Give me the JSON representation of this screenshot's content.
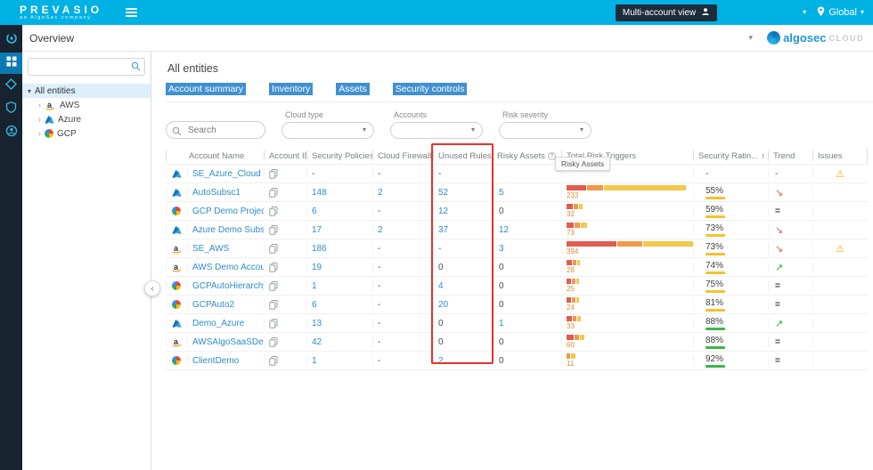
{
  "topbar": {
    "brand": "PREVASIO",
    "brand_sub": "an AlgoSec company",
    "multi_account": "Multi-account view",
    "region": "Global"
  },
  "header": {
    "title": "Overview",
    "logo_text": "algosec",
    "logo_sub": "CLOUD"
  },
  "tree": {
    "search_placeholder": "",
    "root_label": "All entities",
    "items": [
      {
        "label": "AWS",
        "provider": "aws"
      },
      {
        "label": "Azure",
        "provider": "azure"
      },
      {
        "label": "GCP",
        "provider": "gcp"
      }
    ]
  },
  "main": {
    "title": "All entities",
    "tabs": [
      "Account summary",
      "Inventory",
      "Assets",
      "Security controls"
    ],
    "active_tab": "Account summary",
    "filters": {
      "search_placeholder": "Search",
      "cloud_type": "Cloud type",
      "accounts": "Accounts",
      "risk_severity": "Risk severity"
    },
    "tooltip": "Risky Assets"
  },
  "table": {
    "columns": [
      "Account Name",
      "Account ID",
      "Security Policies",
      "Cloud Firewalls",
      "Unused Rules",
      "Risky Assets",
      "Total Risk Triggers",
      "Security Ratin...",
      "Trend",
      "Issues"
    ],
    "rows": [
      {
        "provider": "azure",
        "name": "SE_Azure_Cloud",
        "policies": "-",
        "firewalls": "-",
        "unused": "-",
        "risky": "",
        "triggers": null,
        "rating": "-",
        "rating_level": null,
        "trend": "-",
        "issue": true
      },
      {
        "provider": "azure",
        "name": "AutoSubsc1",
        "policies": "148",
        "firewalls": "2",
        "unused": "52",
        "risky": "5",
        "triggers": {
          "total": "233",
          "segments": [
            [
              "red",
              22
            ],
            [
              "orange",
              18
            ],
            [
              "yellow",
              92
            ]
          ]
        },
        "rating": "55%",
        "rating_level": "yellow",
        "trend": "down",
        "issue": false
      },
      {
        "provider": "gcp",
        "name": "GCP Demo Project",
        "policies": "6",
        "firewalls": "-",
        "unused": "12",
        "risky": "0",
        "triggers": {
          "total": "32",
          "segments": [
            [
              "red",
              7
            ],
            [
              "orange",
              5
            ],
            [
              "yellow",
              4
            ]
          ]
        },
        "rating": "59%",
        "rating_level": "yellow",
        "trend": "flat",
        "issue": false
      },
      {
        "provider": "azure",
        "name": "Azure Demo Subscriptio",
        "policies": "17",
        "firewalls": "2",
        "unused": "37",
        "risky": "12",
        "triggers": {
          "total": "73",
          "segments": [
            [
              "red",
              8
            ],
            [
              "orange",
              6
            ],
            [
              "yellow",
              7
            ]
          ]
        },
        "rating": "73%",
        "rating_level": "yellow",
        "trend": "down",
        "issue": false
      },
      {
        "provider": "aws",
        "name": "SE_AWS",
        "policies": "186",
        "firewalls": "-",
        "unused": "-",
        "risky": "3",
        "triggers": {
          "total": "394",
          "segments": [
            [
              "red",
              56
            ],
            [
              "orange",
              28
            ],
            [
              "yellow",
              74
            ]
          ]
        },
        "rating": "73%",
        "rating_level": "yellow",
        "trend": "down",
        "issue": true
      },
      {
        "provider": "aws",
        "name": "AWS Demo Account",
        "policies": "19",
        "firewalls": "-",
        "unused": "0",
        "risky": "0",
        "triggers": {
          "total": "28",
          "segments": [
            [
              "red",
              6
            ],
            [
              "orange",
              4
            ],
            [
              "yellow",
              3
            ]
          ]
        },
        "rating": "74%",
        "rating_level": "yellow",
        "trend": "up",
        "issue": false
      },
      {
        "provider": "gcp",
        "name": "GCPAutoHierarchy",
        "policies": "1",
        "firewalls": "-",
        "unused": "4",
        "risky": "0",
        "triggers": {
          "total": "25",
          "segments": [
            [
              "red",
              5
            ],
            [
              "orange",
              4
            ],
            [
              "yellow",
              3
            ]
          ]
        },
        "rating": "75%",
        "rating_level": "yellow",
        "trend": "flat",
        "issue": false
      },
      {
        "provider": "gcp",
        "name": "GCPAuto2",
        "policies": "6",
        "firewalls": "-",
        "unused": "20",
        "risky": "0",
        "triggers": {
          "total": "24",
          "segments": [
            [
              "red",
              5
            ],
            [
              "orange",
              4
            ],
            [
              "yellow",
              3
            ]
          ]
        },
        "rating": "81%",
        "rating_level": "yellow",
        "trend": "flat",
        "issue": false
      },
      {
        "provider": "azure",
        "name": "Demo_Azure",
        "policies": "13",
        "firewalls": "-",
        "unused": "0",
        "risky": "1",
        "triggers": {
          "total": "33",
          "segments": [
            [
              "red",
              6
            ],
            [
              "orange",
              4
            ],
            [
              "yellow",
              4
            ]
          ]
        },
        "rating": "88%",
        "rating_level": "green",
        "trend": "up",
        "issue": false
      },
      {
        "provider": "aws",
        "name": "AWSAlgoSaaSDevAccou",
        "policies": "42",
        "firewalls": "-",
        "unused": "0",
        "risky": "0",
        "triggers": {
          "total": "60",
          "segments": [
            [
              "red",
              8
            ],
            [
              "orange",
              5
            ],
            [
              "yellow",
              5
            ]
          ]
        },
        "rating": "88%",
        "rating_level": "green",
        "trend": "flat",
        "issue": false
      },
      {
        "provider": "gcp",
        "name": "ClientDemo",
        "policies": "1",
        "firewalls": "-",
        "unused": "2",
        "risky": "0",
        "triggers": {
          "total": "11",
          "segments": [
            [
              "orange",
              4
            ],
            [
              "yellow",
              5
            ]
          ]
        },
        "rating": "92%",
        "rating_level": "green",
        "trend": "flat",
        "issue": false
      }
    ]
  },
  "icons": {
    "caret_down": "▾",
    "chevron_right": "›",
    "chevron_left": "‹",
    "trend_up": "↗",
    "trend_down": "↘",
    "trend_flat": "=",
    "warning": "⚠",
    "sort_asc": "↑",
    "help": "?"
  },
  "colors": {
    "topbar": "#00b1e4",
    "link": "#2b8dcb",
    "bar_red": "#e05c4f",
    "bar_orange": "#f2994a",
    "bar_yellow": "#f2c94c",
    "rating_yellow": "#f2c230",
    "rating_green": "#3db54a",
    "annotation_red": "#e8312a"
  }
}
